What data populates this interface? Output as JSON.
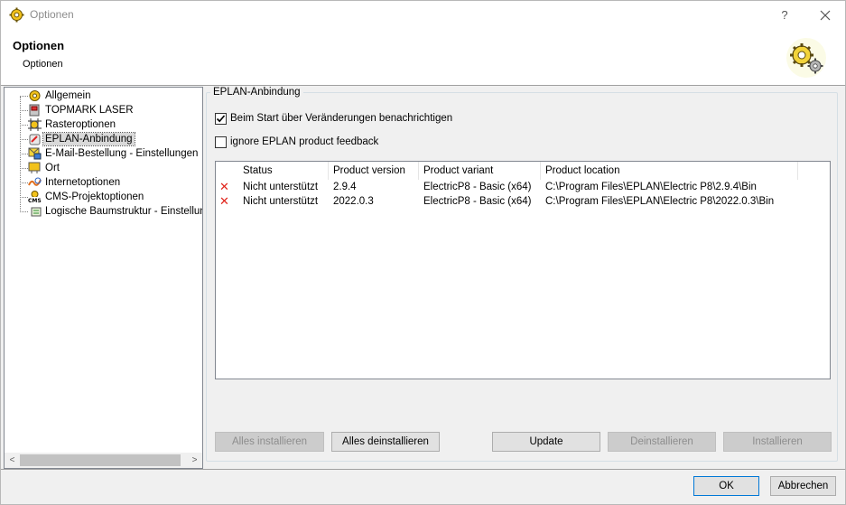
{
  "window": {
    "title": "Optionen",
    "help_glyph": "?",
    "close_glyph": "✕"
  },
  "header": {
    "title": "Optionen",
    "subtitle": "Optionen"
  },
  "tree": {
    "items": [
      {
        "label": "Allgemein",
        "icon": "settings-icon"
      },
      {
        "label": "TOPMARK LASER",
        "icon": "laser-icon"
      },
      {
        "label": "Rasteroptionen",
        "icon": "grid-icon"
      },
      {
        "label": "EPLAN-Anbindung",
        "icon": "eplan-icon",
        "selected": true
      },
      {
        "label": "E-Mail-Bestellung - Einstellungen",
        "icon": "email-icon"
      },
      {
        "label": "Ort",
        "icon": "location-icon"
      },
      {
        "label": "Internetoptionen",
        "icon": "internet-icon"
      },
      {
        "label": "CMS-Projektoptionen",
        "icon": "cms-icon"
      },
      {
        "label": "Logische Baumstruktur - Einstellungen",
        "icon": "tree-structure-icon"
      }
    ]
  },
  "panel": {
    "group_title": "EPLAN-Anbindung",
    "check_notify": {
      "label": "Beim Start über Veränderungen benachrichtigen",
      "checked": true
    },
    "check_ignore": {
      "label": "ignore EPLAN product feedback",
      "checked": false
    }
  },
  "list": {
    "columns": [
      "Status",
      "Product version",
      "Product variant",
      "Product location"
    ],
    "rows": [
      {
        "status": "Nicht unterstützt",
        "version": "2.9.4",
        "variant": "ElectricP8 - Basic (x64)",
        "location": "C:\\Program Files\\EPLAN\\Electric P8\\2.9.4\\Bin"
      },
      {
        "status": "Nicht unterstützt",
        "version": "2022.0.3",
        "variant": "ElectricP8 - Basic (x64)",
        "location": "C:\\Program Files\\EPLAN\\Electric P8\\2022.0.3\\Bin"
      }
    ],
    "status_icon": "error-x-icon",
    "status_color": "#e0241b"
  },
  "buttons": {
    "install_all": "Alles installieren",
    "uninstall_all": "Alles deinstallieren",
    "update": "Update",
    "uninstall": "Deinstallieren",
    "install": "Installieren",
    "ok": "OK",
    "cancel": "Abbrechen"
  },
  "scroll": {
    "left_glyph": "<",
    "right_glyph": ">"
  }
}
